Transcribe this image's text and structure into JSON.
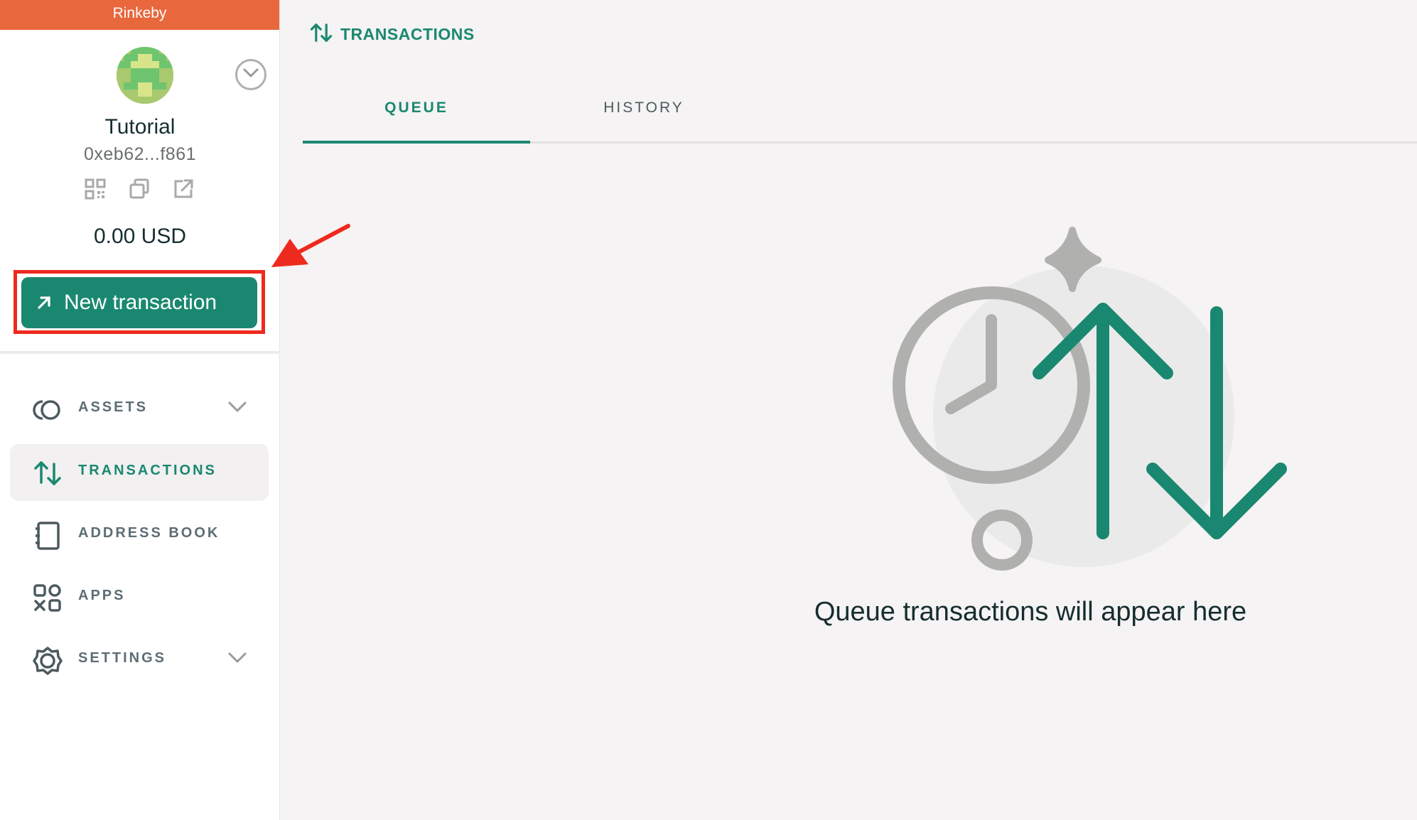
{
  "network": {
    "name": "Rinkeby",
    "color": "#e8673c"
  },
  "safe": {
    "name": "Tutorial",
    "address": "0xeb62...f861",
    "balance": "0.00 USD",
    "actions": [
      "qr-code-icon",
      "copy-icon",
      "external-link-icon"
    ]
  },
  "new_transaction": {
    "label": "New transaction",
    "icon": "arrow-up-right-icon"
  },
  "nav": {
    "items": [
      {
        "label": "ASSETS",
        "icon": "coins-icon",
        "expandable": true,
        "active": false
      },
      {
        "label": "TRANSACTIONS",
        "icon": "transactions-icon",
        "expandable": false,
        "active": true
      },
      {
        "label": "ADDRESS BOOK",
        "icon": "address-book-icon",
        "expandable": false,
        "active": false
      },
      {
        "label": "APPS",
        "icon": "apps-icon",
        "expandable": false,
        "active": false
      },
      {
        "label": "SETTINGS",
        "icon": "gear-icon",
        "expandable": true,
        "active": false
      }
    ]
  },
  "header": {
    "title": "TRANSACTIONS",
    "icon": "transactions-icon"
  },
  "tabs": [
    {
      "label": "QUEUE",
      "active": true
    },
    {
      "label": "HISTORY",
      "active": false
    }
  ],
  "empty_state": {
    "message": "Queue transactions will appear here"
  },
  "colors": {
    "accent": "#1a8870",
    "highlight": "#ee2a1e",
    "text": "#162d2f",
    "muted": "#5d6d74"
  }
}
